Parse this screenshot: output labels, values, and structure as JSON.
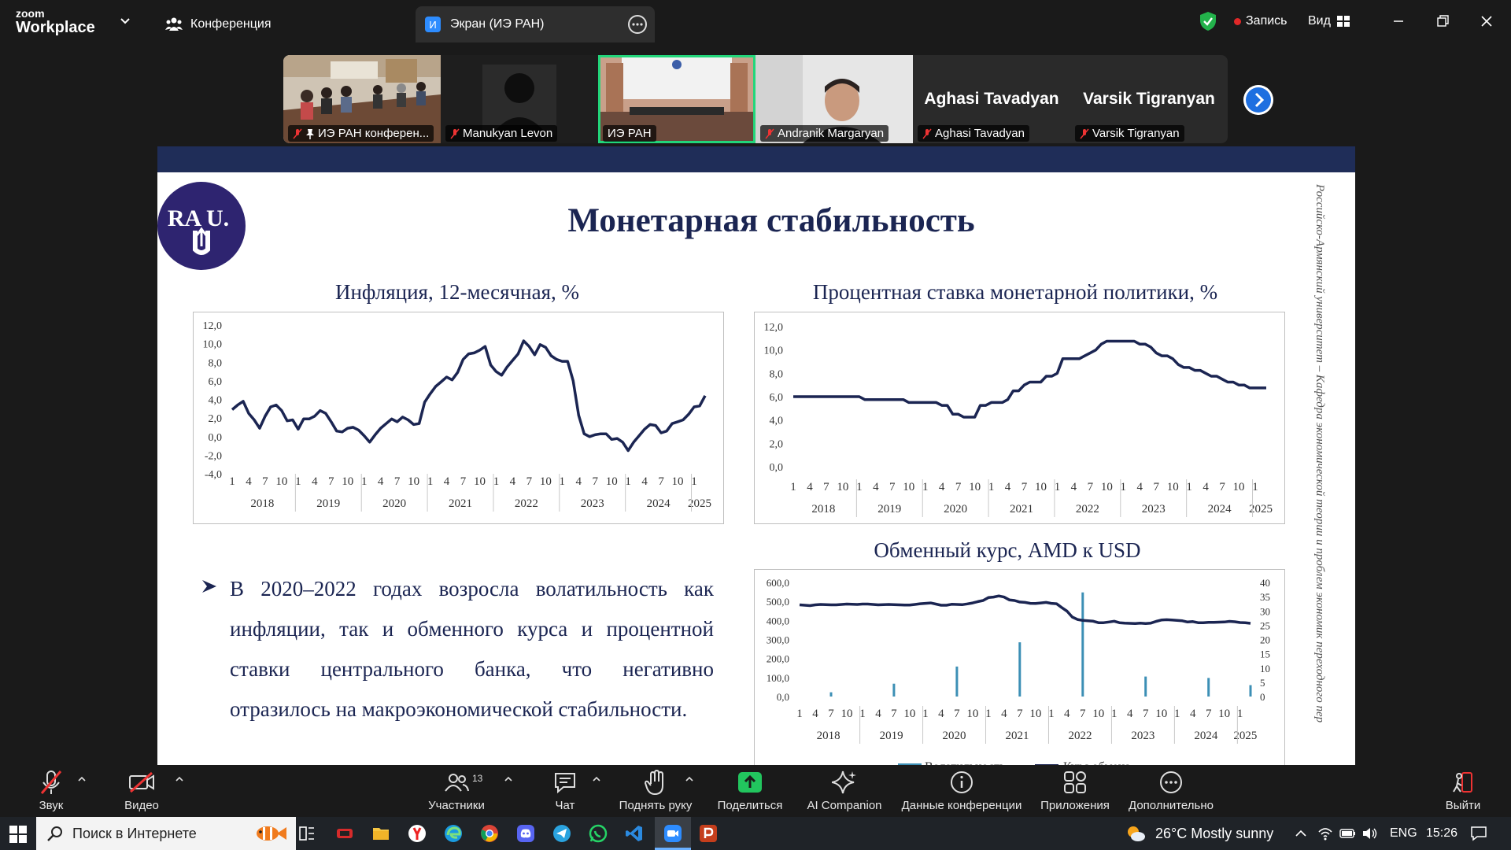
{
  "app": {
    "logo_line1": "zoom",
    "logo_line2": "Workplace",
    "tab_conference": "Конференция",
    "tab_screen_badge": "И",
    "tab_screen": "Экран (ИЭ РАН)",
    "record_label": "Запись",
    "view_label": "Вид",
    "accent": "#2d8cff"
  },
  "participants": [
    {
      "name": "ИЭ РАН конферен...",
      "video": "room"
    },
    {
      "name": "Manukyan Levon",
      "video": "avatar"
    },
    {
      "name": "ИЭ РАН",
      "video": "hall",
      "active": true
    },
    {
      "name": "Andranik Margaryan",
      "video": "person"
    },
    {
      "name": "Aghasi Tavadyan",
      "video": "none"
    },
    {
      "name": "Varsik Tigranyan",
      "video": "none"
    }
  ],
  "slide": {
    "logo_text": "RA U.",
    "title": "Монетарная стабильность",
    "side_text": "Российско-Армянский университет – Кафедра экономической теории и проблем экономик переходного пер",
    "bullet": "В 2020–2022 годах возросла волатильность как инфляции, так и обменного курса и процентной ставки центрального банка, что негативно",
    "bullet_last": "отразилось на макроэкономической стабильности.",
    "colors": {
      "navy": "#1b2552",
      "bar": "#3c8fb5"
    }
  },
  "chart_data": [
    {
      "type": "line",
      "title": "Инфляция, 12-месячная, %",
      "yticks": [
        "12,0",
        "10,0",
        "8,0",
        "6,0",
        "4,0",
        "2,0",
        "0,0",
        "-2,0",
        "-4,0"
      ],
      "ylim": [
        -4,
        12
      ],
      "month_ticks": [
        "1",
        "4",
        "7",
        "10"
      ],
      "years": [
        "2018",
        "2019",
        "2020",
        "2021",
        "2022",
        "2023",
        "2024",
        "2025"
      ],
      "x_start": "2018-01",
      "values": [
        2.9,
        3.4,
        3.8,
        2.5,
        1.8,
        0.9,
        2.2,
        3.2,
        3.4,
        2.8,
        1.7,
        1.8,
        0.8,
        1.9,
        1.9,
        2.2,
        2.8,
        2.5,
        1.6,
        0.6,
        0.5,
        0.9,
        1.0,
        0.7,
        0.1,
        -0.6,
        0.2,
        0.9,
        1.4,
        1.9,
        1.6,
        2.1,
        1.8,
        1.3,
        1.4,
        3.7,
        4.6,
        5.4,
        5.9,
        6.4,
        6.1,
        6.9,
        8.3,
        8.9,
        9.0,
        9.3,
        9.7,
        7.7,
        7.0,
        6.6,
        7.5,
        8.2,
        8.9,
        10.3,
        9.7,
        8.8,
        9.9,
        9.6,
        8.7,
        8.3,
        8.1,
        8.1,
        6.0,
        2.3,
        0.3,
        0.0,
        0.2,
        0.3,
        0.3,
        -0.3,
        -0.2,
        -0.6,
        -1.5,
        -0.6,
        0.1,
        0.8,
        1.3,
        1.2,
        0.4,
        0.6,
        1.4,
        1.6,
        1.8,
        2.4,
        3.2,
        3.3,
        4.4
      ]
    },
    {
      "type": "line",
      "title": "Процентная ставка монетарной политики, %",
      "yticks": [
        "12,0",
        "10,0",
        "8,0",
        "6,0",
        "4,0",
        "2,0",
        "0,0"
      ],
      "ylim": [
        0,
        12
      ],
      "month_ticks": [
        "1",
        "4",
        "7",
        "10"
      ],
      "years": [
        "2018",
        "2019",
        "2020",
        "2021",
        "2022",
        "2023",
        "2024",
        "2025"
      ],
      "x_start": "2018-01",
      "values": [
        6.0,
        6.0,
        6.0,
        6.0,
        6.0,
        6.0,
        6.0,
        6.0,
        6.0,
        6.0,
        6.0,
        6.0,
        6.0,
        5.75,
        5.75,
        5.75,
        5.75,
        5.75,
        5.75,
        5.75,
        5.75,
        5.5,
        5.5,
        5.5,
        5.5,
        5.5,
        5.5,
        5.25,
        5.25,
        4.5,
        4.5,
        4.25,
        4.25,
        4.25,
        5.25,
        5.25,
        5.5,
        5.5,
        5.5,
        5.75,
        6.5,
        6.5,
        7.0,
        7.25,
        7.25,
        7.25,
        7.75,
        7.75,
        8.0,
        9.25,
        9.25,
        9.25,
        9.25,
        9.5,
        9.75,
        10.0,
        10.5,
        10.75,
        10.75,
        10.75,
        10.75,
        10.75,
        10.75,
        10.5,
        10.5,
        10.25,
        9.75,
        9.5,
        9.5,
        9.25,
        8.75,
        8.5,
        8.5,
        8.25,
        8.25,
        8.0,
        7.75,
        7.75,
        7.5,
        7.25,
        7.25,
        7.0,
        7.0,
        6.75,
        6.75,
        6.75,
        6.75
      ]
    },
    {
      "type": "bar+line",
      "title": "Обменный курс, AMD к USD",
      "yticks_left": [
        "600,0",
        "500,0",
        "400,0",
        "300,0",
        "200,0",
        "100,0",
        "0,0"
      ],
      "ylim_left": [
        0,
        600
      ],
      "yticks_right": [
        "40",
        "35",
        "30",
        "25",
        "20",
        "15",
        "10",
        "5",
        "0"
      ],
      "ylim_right": [
        0,
        40
      ],
      "month_ticks": [
        "1",
        "4",
        "7",
        "10"
      ],
      "years": [
        "2018",
        "2019",
        "2020",
        "2021",
        "2022",
        "2023",
        "2024",
        "2025"
      ],
      "x_start": "2018-01",
      "legend": [
        "Волатильность",
        "Курс обмена"
      ],
      "exchange_rate": [
        482,
        480,
        478,
        482,
        484,
        483,
        482,
        482,
        484,
        486,
        485,
        484,
        486,
        486,
        484,
        482,
        483,
        484,
        483,
        482,
        481,
        481,
        484,
        488,
        490,
        492,
        486,
        480,
        480,
        485,
        484,
        483,
        487,
        492,
        499,
        505,
        520,
        523,
        529,
        523,
        508,
        505,
        497,
        495,
        490,
        489,
        492,
        495,
        490,
        488,
        468,
        449,
        418,
        405,
        400,
        398,
        396,
        388,
        388,
        392,
        396,
        388,
        386,
        385,
        384,
        386,
        384,
        386,
        395,
        402,
        404,
        402,
        400,
        398,
        392,
        394,
        388,
        388,
        390,
        390,
        391,
        392,
        395,
        393,
        389,
        388,
        385
      ],
      "volatility": [
        {
          "index": 6,
          "value": 1.5
        },
        {
          "index": 18,
          "value": 4.5
        },
        {
          "index": 30,
          "value": 10.5
        },
        {
          "index": 42,
          "value": 19
        },
        {
          "index": 54,
          "value": 36.5
        },
        {
          "index": 66,
          "value": 7
        },
        {
          "index": 78,
          "value": 6.5
        },
        {
          "index": 86,
          "value": 4
        }
      ]
    }
  ],
  "toolbar": {
    "audio": "Звук",
    "video": "Видео",
    "participants": "Участники",
    "participants_count": "13",
    "chat": "Чат",
    "raise_hand": "Поднять руку",
    "share": "Поделиться",
    "ai": "AI Companion",
    "info": "Данные конференции",
    "apps": "Приложения",
    "more": "Дополнительно",
    "leave": "Выйти"
  },
  "taskbar": {
    "search_placeholder": "Поиск в Интернете",
    "weather": "26°C  Mostly sunny",
    "lang": "ENG",
    "time": "15:26"
  }
}
